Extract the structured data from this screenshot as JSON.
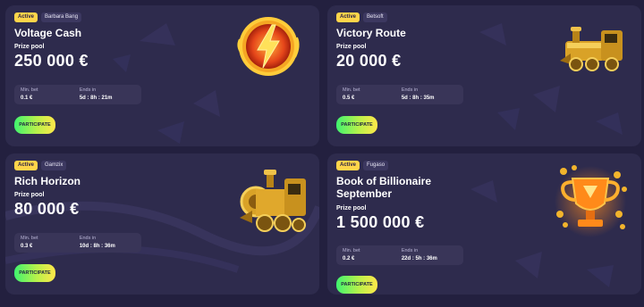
{
  "cards": [
    {
      "status": "Active",
      "provider": "Barbara Bang",
      "title": "Voltage Cash",
      "prize_label": "Prize pool",
      "prize_value": "250 000 €",
      "min_bet_label": "Min. bet",
      "min_bet": "0.1 €",
      "ends_label": "Ends in",
      "ends_in": "5d : 8h : 21m",
      "button": "PARTICIPATE",
      "art_icon": "lightning-coin-icon"
    },
    {
      "status": "Active",
      "provider": "Betsoft",
      "title": "Victory Route",
      "prize_label": "Prize pool",
      "prize_value": "20 000 €",
      "min_bet_label": "Min. bet",
      "min_bet": "0.5 €",
      "ends_label": "Ends in",
      "ends_in": "5d : 8h : 35m",
      "button": "PARTICIPATE",
      "art_icon": "gold-train-icon"
    },
    {
      "status": "Active",
      "provider": "Gamzix",
      "title": "Rich Horizon",
      "prize_label": "Prize pool",
      "prize_value": "80 000 €",
      "min_bet_label": "Min. bet",
      "min_bet": "0.3 €",
      "ends_label": "Ends in",
      "ends_in": "10d : 8h : 36m",
      "button": "PARTICIPATE",
      "art_icon": "gold-train-icon"
    },
    {
      "status": "Active",
      "provider": "Fugaso",
      "title_line1": "Book of Billionaire",
      "title_line2": "September",
      "prize_label": "Prize pool",
      "prize_value": "1 500 000 €",
      "min_bet_label": "Min. bet",
      "min_bet": "0.2 €",
      "ends_label": "Ends in",
      "ends_in": "22d : 5h : 36m",
      "button": "PARTICIPATE",
      "art_icon": "trophy-icon"
    }
  ],
  "colors": {
    "background": "#23203f",
    "card": "#2e2b4d",
    "active_badge": "#ffd54a",
    "button_gradient_start": "#3ff36f",
    "button_gradient_end": "#ffe74a"
  }
}
